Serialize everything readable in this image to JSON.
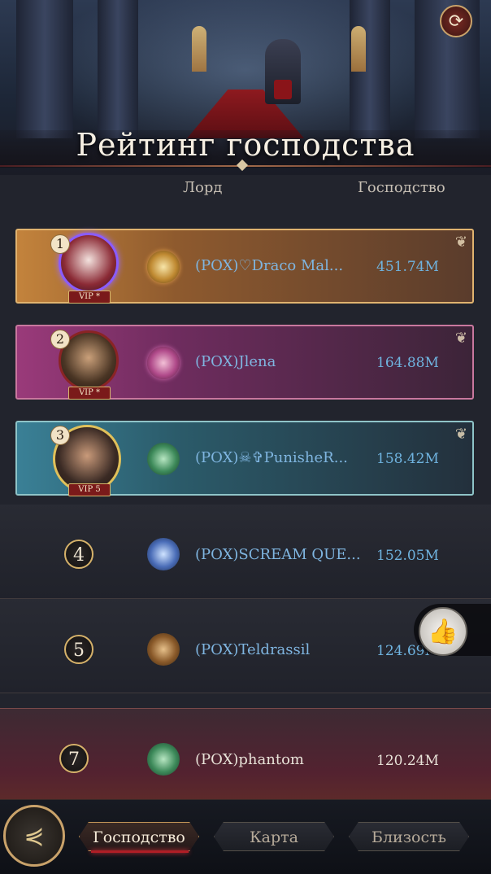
{
  "header": {
    "title": "Рейтинг господства",
    "refresh_icon": "refresh-icon"
  },
  "columns": {
    "lord": "Лорд",
    "dominance": "Господство"
  },
  "rows": [
    {
      "rank": "1",
      "vip": "VIP *",
      "name": "(POX)♡Draco Mal...",
      "score": "451.74M"
    },
    {
      "rank": "2",
      "vip": "VIP *",
      "name": "(POX)Jlena",
      "score": "164.88M"
    },
    {
      "rank": "3",
      "vip": "VIP 5",
      "name": "(POX)☠✞PunisheR...",
      "score": "158.42M"
    },
    {
      "rank": "4",
      "name": "(POX)SCREAM QUE...",
      "score": "152.05M"
    },
    {
      "rank": "5",
      "name": "(POX)Teldrassil",
      "score": "124.69M"
    }
  ],
  "my_rank": {
    "rank": "7",
    "name": "(POX)phantom",
    "score": "120.24M"
  },
  "tabs": {
    "dominance": "Господство",
    "map": "Карта",
    "intimacy": "Близость"
  },
  "icons": {
    "like": "thumbs-up-icon",
    "menu": "menu-emblem-icon"
  }
}
